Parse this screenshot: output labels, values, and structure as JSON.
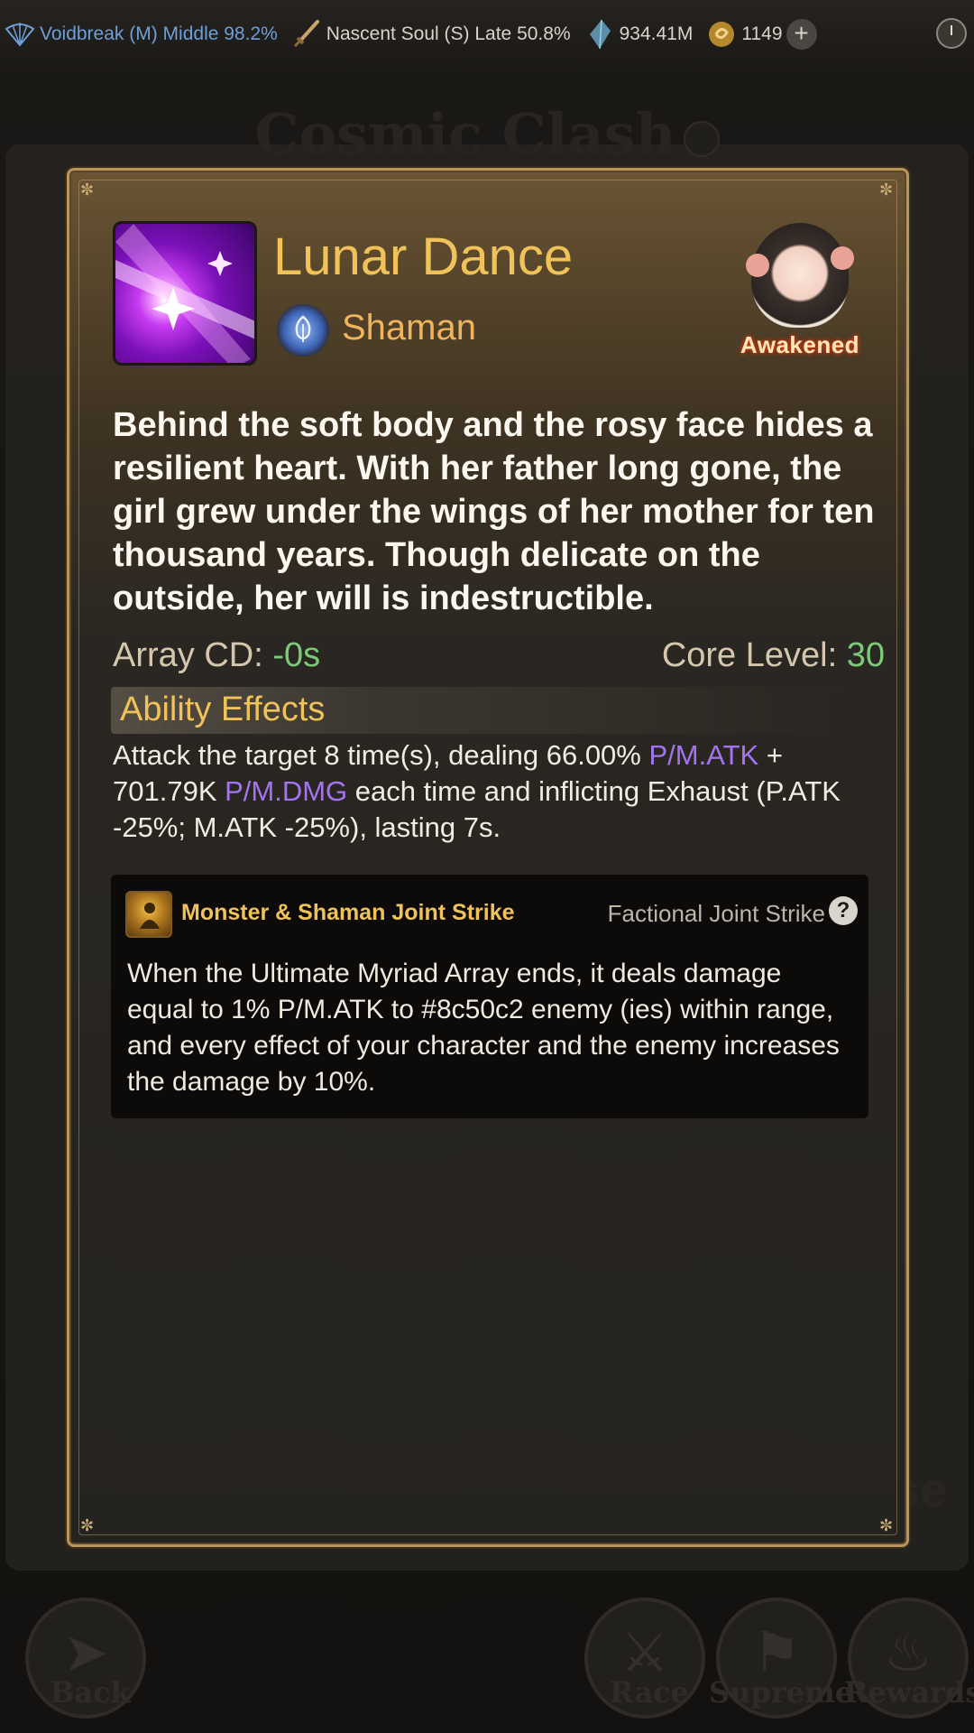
{
  "topbar": {
    "realm": "Voidbreak (M) Middle 98.2%",
    "cultivation": "Nascent Soul (S) Late 50.8%",
    "spirit_stones": "934.41M",
    "gold": "1149",
    "plus_label": "+"
  },
  "background": {
    "title": "Cosmic Clash",
    "side_text": "se",
    "nav": [
      {
        "label": "Back"
      },
      {
        "label": "Race"
      },
      {
        "label": "Supreme"
      },
      {
        "label": "Rewards"
      }
    ]
  },
  "skill": {
    "name": "Lunar Dance",
    "class": "Shaman",
    "badge": "Awakened",
    "lore": "Behind the soft body and the rosy face hides a resilient heart. With her father long gone, the girl grew under the wings of her mother for ten thousand years. Though delicate on the outside, her will is indestructible.",
    "array_cd_label": "Array CD: ",
    "array_cd_value": "-0s",
    "core_level_label": "Core Level: ",
    "core_level_value": "30"
  },
  "effects": {
    "title": "Ability Effects",
    "text_part1": "Attack the target 8 time(s), dealing 66.00% ",
    "hl1": "P/M.ATK",
    "text_part2": " + 701.79K ",
    "hl2": "P/M.DMG",
    "text_part3": " each time and inflicting Exhaust (P.ATK -25%; M.ATK -25%), lasting 7s."
  },
  "joint_strike": {
    "title": "Monster & Shaman Joint Strike",
    "type": "Factional Joint Strike",
    "help_label": "?",
    "description": "When the Ultimate Myriad Array ends, it deals damage equal to 1% P/M.ATK to #8c50c2 enemy (ies) within range, and every effect of your character and the enemy increases the damage by 10%."
  },
  "colors": {
    "gold_title": "#f0c25a",
    "orange_class": "#efb45c",
    "green_value": "#7cc97a",
    "purple_highlight": "#a474f0",
    "realm_blue": "#6d9fd8"
  },
  "icons": {
    "realm": "fan-icon",
    "cultivation": "sword-icon",
    "spirit_stones": "crystal-icon",
    "gold": "coin-icon",
    "plus": "plus-icon",
    "clock": "clock-icon",
    "skill": "lunar-burst-icon",
    "class": "shaman-emblem-icon",
    "joint": "joint-strike-icon",
    "help": "question-icon"
  }
}
